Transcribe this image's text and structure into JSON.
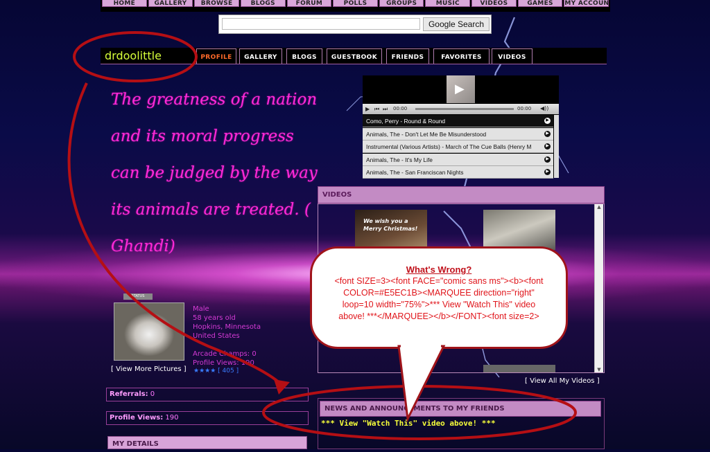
{
  "top_nav": [
    "HOME",
    "GALLERY",
    "BROWSE",
    "BLOGS",
    "FORUM",
    "POLLS",
    "GROUPS",
    "MUSIC",
    "VIDEOS",
    "GAMES",
    "MY ACCOUNT"
  ],
  "search": {
    "button_label": "Google Search",
    "value": ""
  },
  "profile": {
    "username": "drdoolittle",
    "tabs": [
      "PROFILE",
      "GALLERY",
      "BLOGS",
      "GUESTBOOK",
      "FRIENDS",
      "FAVORITES",
      "VIDEOS"
    ],
    "active_tab": "PROFILE"
  },
  "quote_lines": [
    "The greatness of a nation",
    "and its moral progress",
    "can be judged by the way",
    "its animals are treated. (",
    "Ghandi)"
  ],
  "player": {
    "time_left": "00:00",
    "time_right": "00:00",
    "tracks": [
      {
        "title": "Como, Perry - Round & Round",
        "selected": true
      },
      {
        "title": "Animals, The - Don't Let Me Be Misunderstood",
        "selected": false
      },
      {
        "title": "Instrumental (Various Artists) - March of The Cue Balls (Henry M",
        "selected": false
      },
      {
        "title": "Animals, The - It's My Life",
        "selected": false
      },
      {
        "title": "Animals, The - San Franciscan Nights",
        "selected": false
      }
    ]
  },
  "videos": {
    "header": "VIDEOS",
    "thumb1_caption": "We wish you a Merry Christmas!",
    "view_all": "[ View All My Videos ]"
  },
  "callout": {
    "heading": "What's Wrong?",
    "body": "<font SIZE=3><font FACE=\"comic sans ms\"><b><font COLOR=#E5EC1B><MARQUEE direction=\"right\" loop=10 width=\"75%\">*** View \"Watch This\" video above! ***</MARQUEE></b></FONT><font size=2>"
  },
  "user_info": {
    "status_badge": "STATUS",
    "gender": "Male",
    "age": "58 years old",
    "city": "Hopkins, Minnesota",
    "country": "United States",
    "arcade": "Arcade Champs: 0",
    "profile_views_line": "Profile Views: 190",
    "view_more_pictures": "[ View More Pictures ]",
    "stars": "★★★★",
    "star_count": "[ 405 ]"
  },
  "stats": {
    "referrals_label": "Referrals:",
    "referrals_value": "0",
    "views_label": "Profile Views:",
    "views_value": "190"
  },
  "my_details_header": "MY DETAILS",
  "news": {
    "header": "NEWS AND ANNOUNCEMENTS TO MY FRIENDS",
    "marquee": "*** View \"Watch This\" video above! ***"
  },
  "colors": {
    "annotation_red": "#b50f14",
    "username": "#d7ff3a",
    "quote": "#ff2ad8",
    "marquee": "#f7ff3a"
  }
}
